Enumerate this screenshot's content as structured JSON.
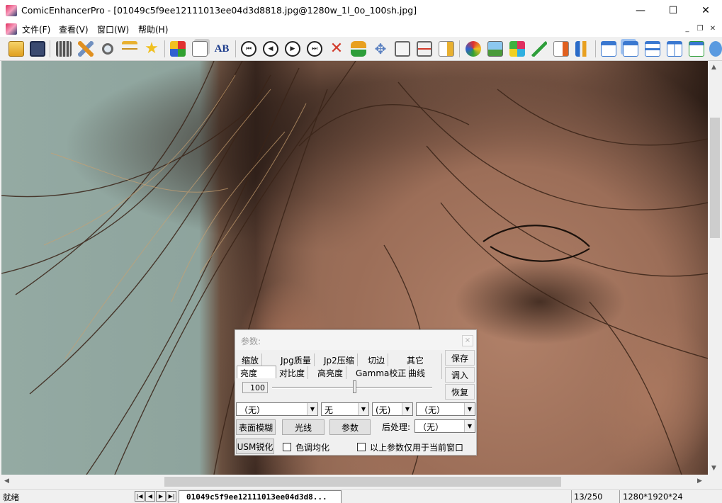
{
  "window": {
    "app_name": "ComicEnhancerPro",
    "title": "ComicEnhancerPro - [01049c5f9ee12111013ee04d3d8818.jpg@1280w_1l_0o_100sh.jpg]",
    "minimize_glyph": "—",
    "maximize_glyph": "☐",
    "close_glyph": "✕"
  },
  "menu": {
    "items": [
      "文件(F)",
      "查看(V)",
      "窗口(W)",
      "帮助(H)"
    ],
    "mdi_min": "_",
    "mdi_restore": "❐",
    "mdi_close": "✕"
  },
  "toolbar": {
    "icons": [
      "open-folder-icon",
      "save-disk-icon",
      "film-icon",
      "tools-icon",
      "magnifier-icon",
      "balance-scale-icon",
      "star-add-icon",
      "color-grid-icon",
      "copy-pages-icon",
      "spellcheck-ab-icon",
      "first-icon",
      "previous-icon",
      "next-icon",
      "last-icon",
      "delete-x-icon",
      "swap-icon",
      "move-icon",
      "fit-icon",
      "width-icon",
      "export-icon",
      "pinwheel-icon",
      "picture-icon",
      "palette-icon",
      "brush-icon",
      "import-icon",
      "sort-icon",
      "new-window-icon",
      "cascade-icon",
      "tile-horizontal-icon",
      "tile-vertical-icon",
      "refresh-windows-icon"
    ],
    "nav_glyphs": {
      "first": "⏮",
      "previous": "◀",
      "next": "▶",
      "last": "⏭"
    },
    "colors": {
      "accent_green": "#2e9e3a",
      "accent_blue": "#2a6bc8",
      "accent_orange": "#e8a020",
      "accent_red": "#d23a2a"
    }
  },
  "params": {
    "title": "参数:",
    "close_glyph": "×",
    "tabs_row1": [
      "缩放",
      "Jpg质量",
      "Jp2压缩",
      "切边",
      "其它"
    ],
    "tabs_row2": [
      "亮度",
      "对比度",
      "高亮度",
      "Gamma校正",
      "曲线"
    ],
    "active_tab": "亮度",
    "save_label": "保存",
    "load_label": "调入",
    "restore_label": "恢复",
    "brightness_value": "100",
    "brightness_fraction": 0.52,
    "select1": "（无）",
    "select2": "无",
    "select3": "(无)",
    "select4": "（无）",
    "surface_blur_label": "表面模糊",
    "light_label": "光线",
    "params_label": "参数",
    "postprocess_label": "后处理:",
    "postprocess_select": "（无）",
    "usm_label": "USM锐化",
    "color_equalize_label": "色调均化",
    "apply_current_label": "以上参数仅用于当前窗口",
    "dropdown_glyph": "▼"
  },
  "status": {
    "ready": "就绪",
    "nav": [
      "|◀",
      "◀",
      "▶",
      "▶|"
    ],
    "file_tab": "01049c5f9ee12111013ee04d3d8...",
    "page": "13/250",
    "dimensions": "1280*1920*24"
  },
  "scroll": {
    "up": "▲",
    "down": "▼",
    "left": "◀",
    "right": "▶"
  }
}
